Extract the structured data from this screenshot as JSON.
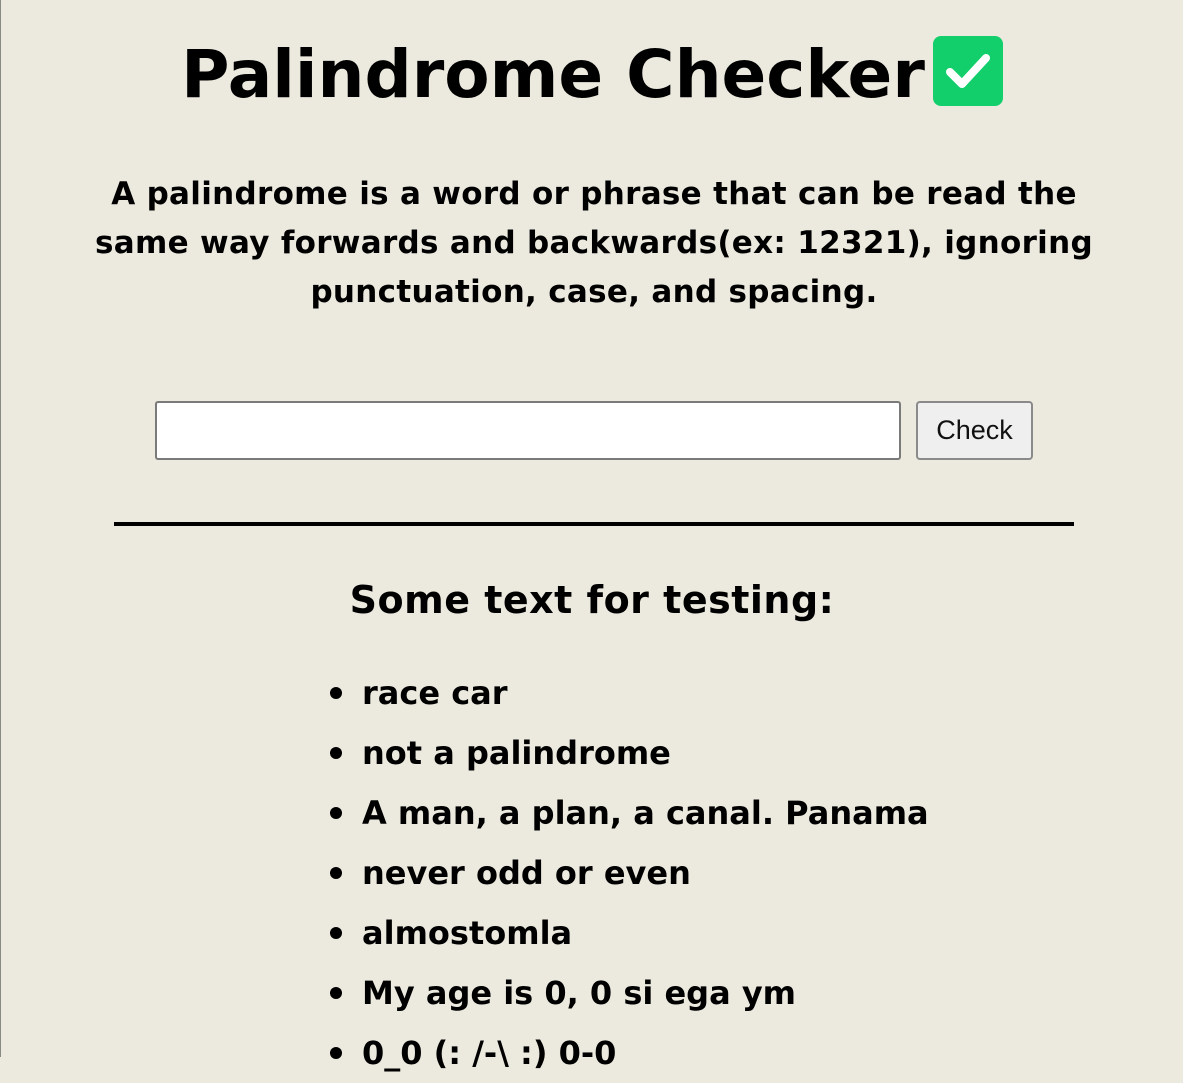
{
  "header": {
    "title": "Palindrome Checker"
  },
  "description": "A palindrome is a word or phrase that can be read the same way forwards and backwards(ex: 12321), ignoring punctuation, case, and spacing.",
  "checker": {
    "input_value": "",
    "check_label": "Check"
  },
  "testing": {
    "heading": "Some text for testing:",
    "items": [
      "race car",
      "not a palindrome",
      "A man, a plan, a canal. Panama",
      "never odd or even",
      "almostomla",
      "My age is 0, 0 si ega ym",
      "0_0 (: /-\\ :) 0-0"
    ]
  },
  "colors": {
    "background": "#ece9de",
    "check_icon": "#12cf6b"
  },
  "icons": {
    "title_icon": "check-mark-button-icon"
  }
}
